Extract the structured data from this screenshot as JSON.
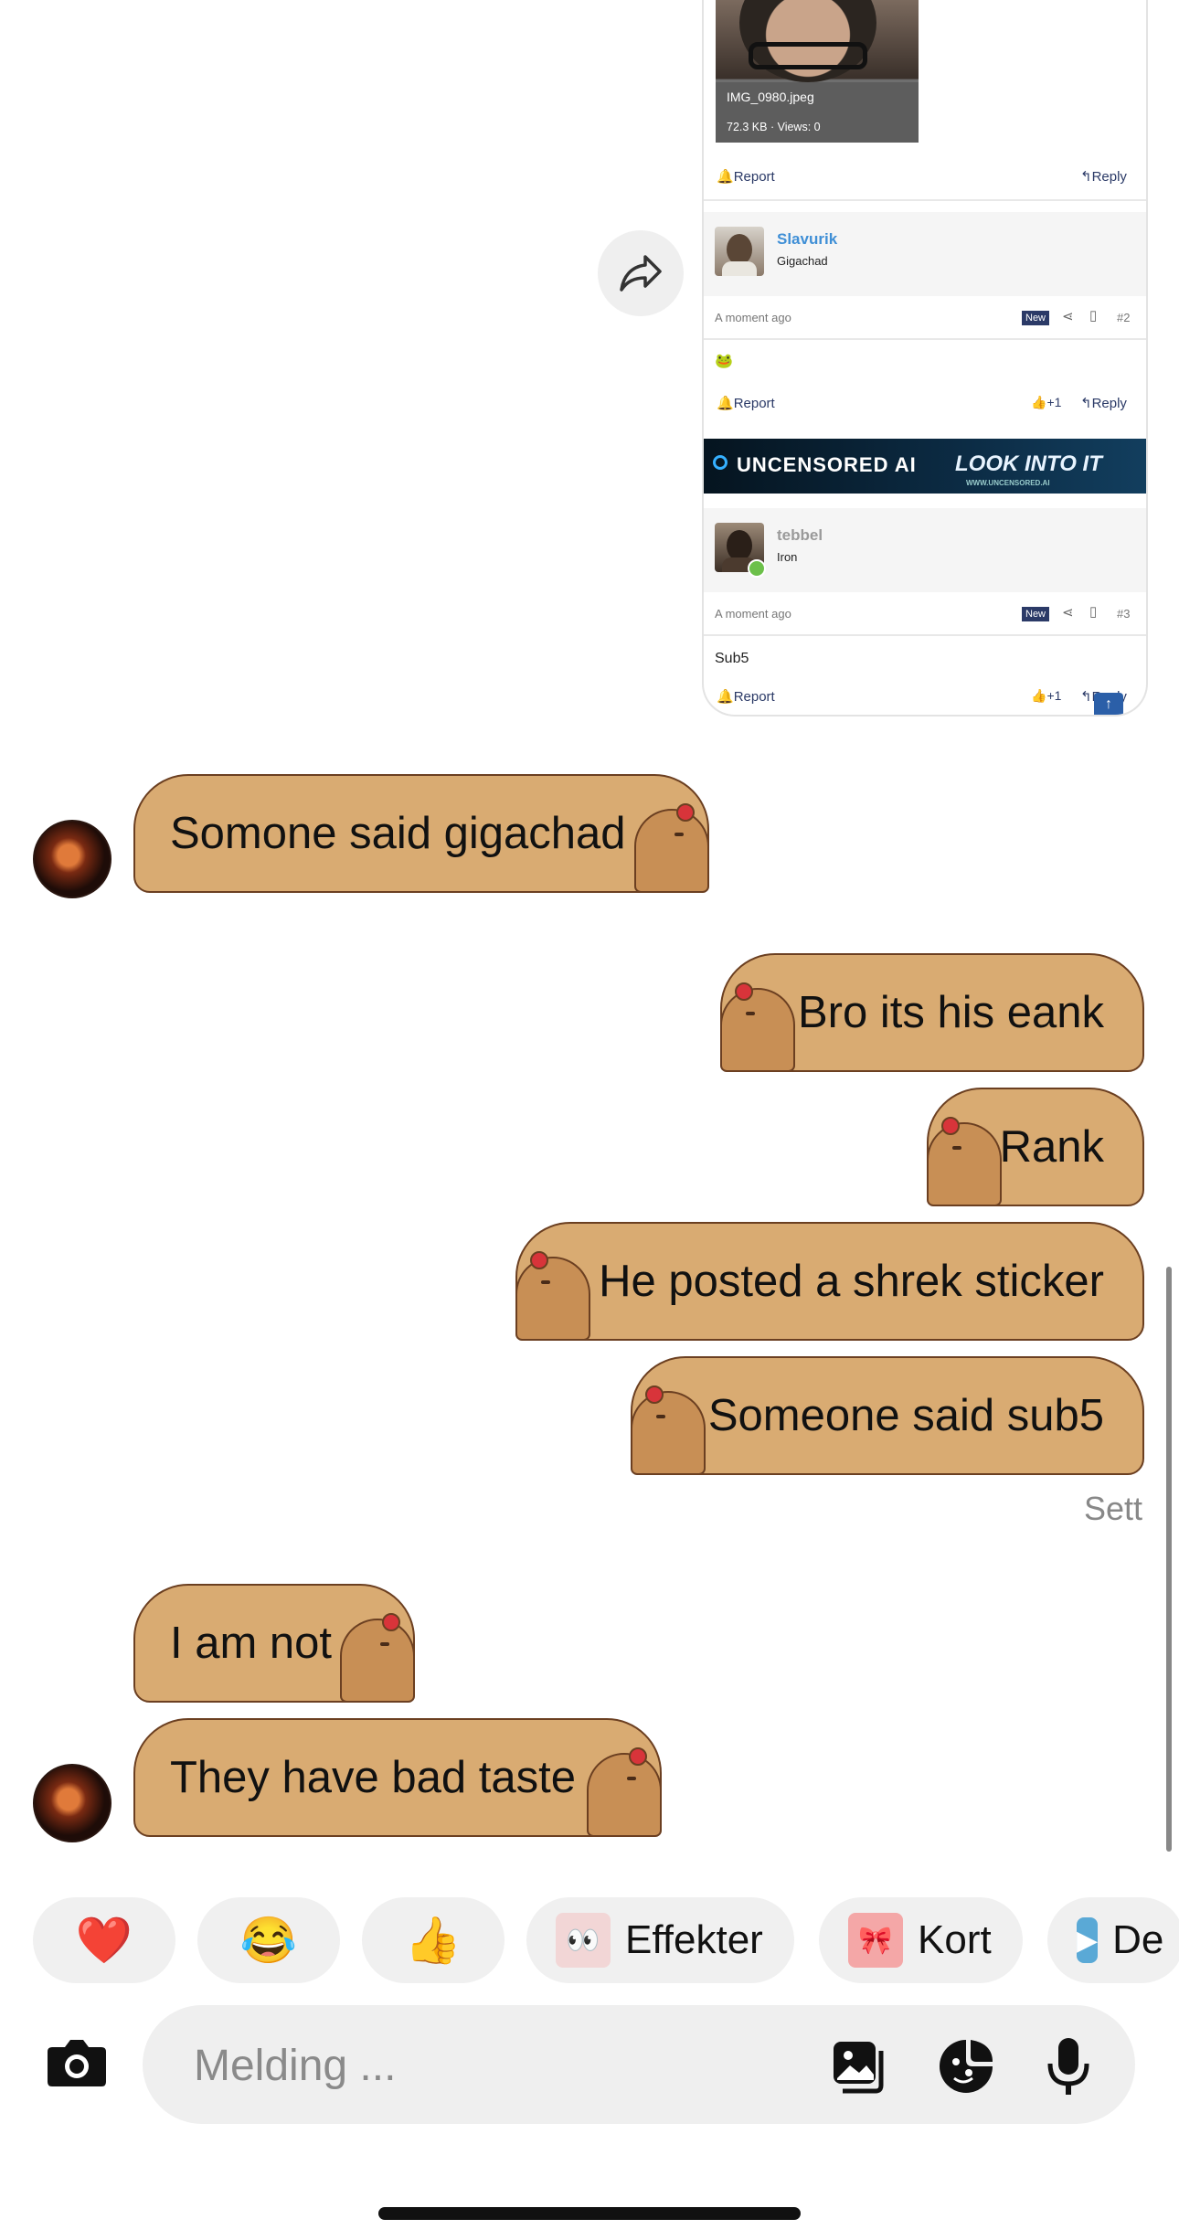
{
  "shared_post": {
    "attachment": {
      "filename": "IMG_0980.jpeg",
      "info": "72.3 KB · Views: 0"
    },
    "report_label": "Report",
    "reply_label": "Reply",
    "posts": [
      {
        "user": "Slavurik",
        "user_color": "#3f8fd6",
        "title": "Gigachad",
        "time": "A moment ago",
        "badge": "New",
        "num": "#2",
        "body": "🐸",
        "likes": "+1"
      },
      {
        "user": "tebbel",
        "user_color": "#9a9a9a",
        "title": "Iron",
        "time": "A moment ago",
        "badge": "New",
        "num": "#3",
        "body": "Sub5",
        "likes": "+1"
      }
    ],
    "ad": {
      "left": "UNCENSORED AI",
      "right": "LOOK INTO IT",
      "url": "WWW.UNCENSORED.AI"
    }
  },
  "messages": [
    {
      "direction": "in",
      "text": "Somone said gigachad"
    },
    {
      "direction": "out",
      "text": "Bro its his eank"
    },
    {
      "direction": "out",
      "text": "Rank"
    },
    {
      "direction": "out",
      "text": "He posted a shrek sticker"
    },
    {
      "direction": "out",
      "text": "Someone said sub5"
    },
    {
      "direction": "in",
      "text": "I am not"
    },
    {
      "direction": "in",
      "text": "They have bad taste"
    }
  ],
  "seen_label": "Sett",
  "quick_reactions": [
    "❤️",
    "😂",
    "👍"
  ],
  "quick_actions": [
    {
      "icon": "effects-icon",
      "label": "Effekter"
    },
    {
      "icon": "card-icon",
      "label": "Kort"
    },
    {
      "icon": "play-icon",
      "label": "De"
    }
  ],
  "composer": {
    "placeholder": "Melding ..."
  },
  "colors": {
    "bubble_fill": "#d9ab72",
    "bubble_outline": "#6b3f21",
    "link": "#2b3a67",
    "badge": "#2b3a67"
  }
}
